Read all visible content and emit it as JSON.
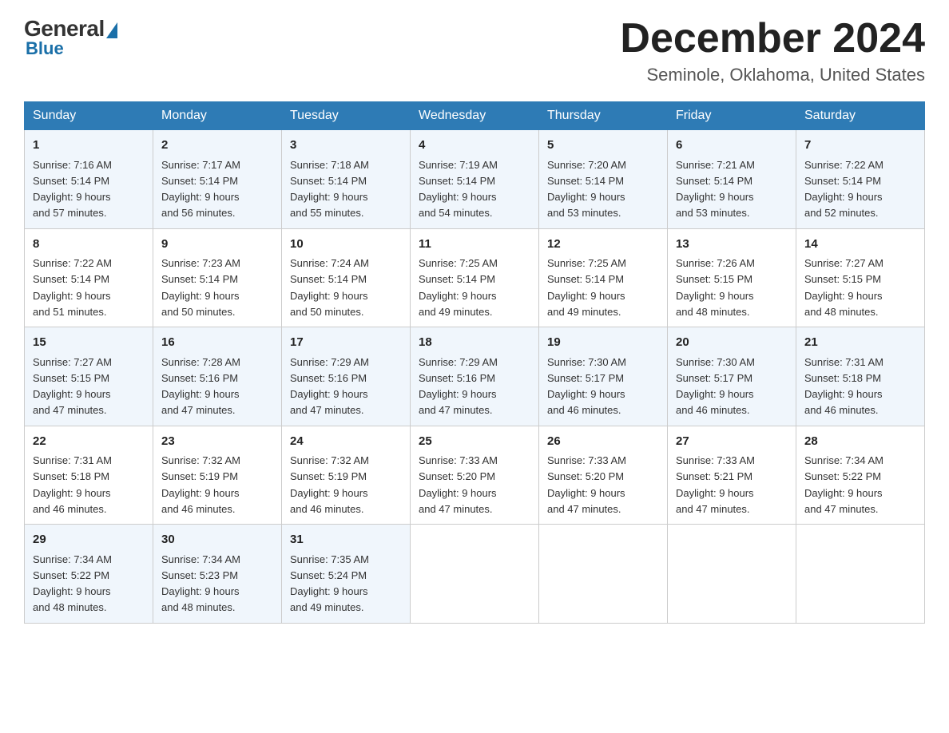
{
  "header": {
    "logo_general": "General",
    "logo_blue": "Blue",
    "month_title": "December 2024",
    "location": "Seminole, Oklahoma, United States"
  },
  "days_of_week": [
    "Sunday",
    "Monday",
    "Tuesday",
    "Wednesday",
    "Thursday",
    "Friday",
    "Saturday"
  ],
  "weeks": [
    [
      {
        "day": "1",
        "sunrise": "7:16 AM",
        "sunset": "5:14 PM",
        "daylight": "9 hours and 57 minutes."
      },
      {
        "day": "2",
        "sunrise": "7:17 AM",
        "sunset": "5:14 PM",
        "daylight": "9 hours and 56 minutes."
      },
      {
        "day": "3",
        "sunrise": "7:18 AM",
        "sunset": "5:14 PM",
        "daylight": "9 hours and 55 minutes."
      },
      {
        "day": "4",
        "sunrise": "7:19 AM",
        "sunset": "5:14 PM",
        "daylight": "9 hours and 54 minutes."
      },
      {
        "day": "5",
        "sunrise": "7:20 AM",
        "sunset": "5:14 PM",
        "daylight": "9 hours and 53 minutes."
      },
      {
        "day": "6",
        "sunrise": "7:21 AM",
        "sunset": "5:14 PM",
        "daylight": "9 hours and 53 minutes."
      },
      {
        "day": "7",
        "sunrise": "7:22 AM",
        "sunset": "5:14 PM",
        "daylight": "9 hours and 52 minutes."
      }
    ],
    [
      {
        "day": "8",
        "sunrise": "7:22 AM",
        "sunset": "5:14 PM",
        "daylight": "9 hours and 51 minutes."
      },
      {
        "day": "9",
        "sunrise": "7:23 AM",
        "sunset": "5:14 PM",
        "daylight": "9 hours and 50 minutes."
      },
      {
        "day": "10",
        "sunrise": "7:24 AM",
        "sunset": "5:14 PM",
        "daylight": "9 hours and 50 minutes."
      },
      {
        "day": "11",
        "sunrise": "7:25 AM",
        "sunset": "5:14 PM",
        "daylight": "9 hours and 49 minutes."
      },
      {
        "day": "12",
        "sunrise": "7:25 AM",
        "sunset": "5:14 PM",
        "daylight": "9 hours and 49 minutes."
      },
      {
        "day": "13",
        "sunrise": "7:26 AM",
        "sunset": "5:15 PM",
        "daylight": "9 hours and 48 minutes."
      },
      {
        "day": "14",
        "sunrise": "7:27 AM",
        "sunset": "5:15 PM",
        "daylight": "9 hours and 48 minutes."
      }
    ],
    [
      {
        "day": "15",
        "sunrise": "7:27 AM",
        "sunset": "5:15 PM",
        "daylight": "9 hours and 47 minutes."
      },
      {
        "day": "16",
        "sunrise": "7:28 AM",
        "sunset": "5:16 PM",
        "daylight": "9 hours and 47 minutes."
      },
      {
        "day": "17",
        "sunrise": "7:29 AM",
        "sunset": "5:16 PM",
        "daylight": "9 hours and 47 minutes."
      },
      {
        "day": "18",
        "sunrise": "7:29 AM",
        "sunset": "5:16 PM",
        "daylight": "9 hours and 47 minutes."
      },
      {
        "day": "19",
        "sunrise": "7:30 AM",
        "sunset": "5:17 PM",
        "daylight": "9 hours and 46 minutes."
      },
      {
        "day": "20",
        "sunrise": "7:30 AM",
        "sunset": "5:17 PM",
        "daylight": "9 hours and 46 minutes."
      },
      {
        "day": "21",
        "sunrise": "7:31 AM",
        "sunset": "5:18 PM",
        "daylight": "9 hours and 46 minutes."
      }
    ],
    [
      {
        "day": "22",
        "sunrise": "7:31 AM",
        "sunset": "5:18 PM",
        "daylight": "9 hours and 46 minutes."
      },
      {
        "day": "23",
        "sunrise": "7:32 AM",
        "sunset": "5:19 PM",
        "daylight": "9 hours and 46 minutes."
      },
      {
        "day": "24",
        "sunrise": "7:32 AM",
        "sunset": "5:19 PM",
        "daylight": "9 hours and 46 minutes."
      },
      {
        "day": "25",
        "sunrise": "7:33 AM",
        "sunset": "5:20 PM",
        "daylight": "9 hours and 47 minutes."
      },
      {
        "day": "26",
        "sunrise": "7:33 AM",
        "sunset": "5:20 PM",
        "daylight": "9 hours and 47 minutes."
      },
      {
        "day": "27",
        "sunrise": "7:33 AM",
        "sunset": "5:21 PM",
        "daylight": "9 hours and 47 minutes."
      },
      {
        "day": "28",
        "sunrise": "7:34 AM",
        "sunset": "5:22 PM",
        "daylight": "9 hours and 47 minutes."
      }
    ],
    [
      {
        "day": "29",
        "sunrise": "7:34 AM",
        "sunset": "5:22 PM",
        "daylight": "9 hours and 48 minutes."
      },
      {
        "day": "30",
        "sunrise": "7:34 AM",
        "sunset": "5:23 PM",
        "daylight": "9 hours and 48 minutes."
      },
      {
        "day": "31",
        "sunrise": "7:35 AM",
        "sunset": "5:24 PM",
        "daylight": "9 hours and 49 minutes."
      },
      null,
      null,
      null,
      null
    ]
  ]
}
